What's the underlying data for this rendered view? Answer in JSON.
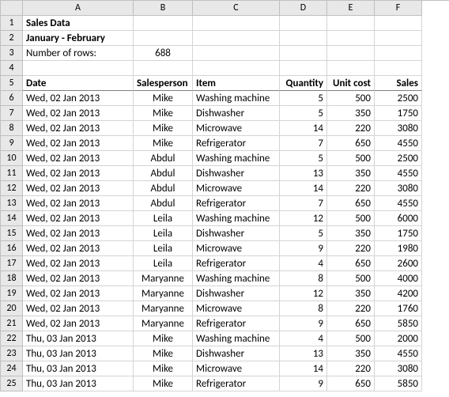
{
  "columns": [
    "A",
    "B",
    "C",
    "D",
    "E",
    "F"
  ],
  "meta": {
    "title": "Sales Data",
    "subtitle": "January - February",
    "rowcount_label": "Number of rows:",
    "rowcount": "688"
  },
  "headers": [
    "Date",
    "Salesperson",
    "Item",
    "Quantity",
    "Unit cost",
    "Sales"
  ],
  "chart_data": {
    "type": "table",
    "columns": [
      "Date",
      "Salesperson",
      "Item",
      "Quantity",
      "Unit cost",
      "Sales"
    ],
    "rows": [
      [
        "Wed, 02 Jan 2013",
        "Mike",
        "Washing machine",
        "5",
        "500",
        "2500"
      ],
      [
        "Wed, 02 Jan 2013",
        "Mike",
        "Dishwasher",
        "5",
        "350",
        "1750"
      ],
      [
        "Wed, 02 Jan 2013",
        "Mike",
        "Microwave",
        "14",
        "220",
        "3080"
      ],
      [
        "Wed, 02 Jan 2013",
        "Mike",
        "Refrigerator",
        "7",
        "650",
        "4550"
      ],
      [
        "Wed, 02 Jan 2013",
        "Abdul",
        "Washing machine",
        "5",
        "500",
        "2500"
      ],
      [
        "Wed, 02 Jan 2013",
        "Abdul",
        "Dishwasher",
        "13",
        "350",
        "4550"
      ],
      [
        "Wed, 02 Jan 2013",
        "Abdul",
        "Microwave",
        "14",
        "220",
        "3080"
      ],
      [
        "Wed, 02 Jan 2013",
        "Abdul",
        "Refrigerator",
        "7",
        "650",
        "4550"
      ],
      [
        "Wed, 02 Jan 2013",
        "Leila",
        "Washing machine",
        "12",
        "500",
        "6000"
      ],
      [
        "Wed, 02 Jan 2013",
        "Leila",
        "Dishwasher",
        "5",
        "350",
        "1750"
      ],
      [
        "Wed, 02 Jan 2013",
        "Leila",
        "Microwave",
        "9",
        "220",
        "1980"
      ],
      [
        "Wed, 02 Jan 2013",
        "Leila",
        "Refrigerator",
        "4",
        "650",
        "2600"
      ],
      [
        "Wed, 02 Jan 2013",
        "Maryanne",
        "Washing machine",
        "8",
        "500",
        "4000"
      ],
      [
        "Wed, 02 Jan 2013",
        "Maryanne",
        "Dishwasher",
        "12",
        "350",
        "4200"
      ],
      [
        "Wed, 02 Jan 2013",
        "Maryanne",
        "Microwave",
        "8",
        "220",
        "1760"
      ],
      [
        "Wed, 02 Jan 2013",
        "Maryanne",
        "Refrigerator",
        "9",
        "650",
        "5850"
      ],
      [
        "Thu, 03 Jan 2013",
        "Mike",
        "Washing machine",
        "4",
        "500",
        "2000"
      ],
      [
        "Thu, 03 Jan 2013",
        "Mike",
        "Dishwasher",
        "13",
        "350",
        "4550"
      ],
      [
        "Thu, 03 Jan 2013",
        "Mike",
        "Microwave",
        "14",
        "220",
        "3080"
      ],
      [
        "Thu, 03 Jan 2013",
        "Mike",
        "Refrigerator",
        "9",
        "650",
        "5850"
      ]
    ]
  }
}
